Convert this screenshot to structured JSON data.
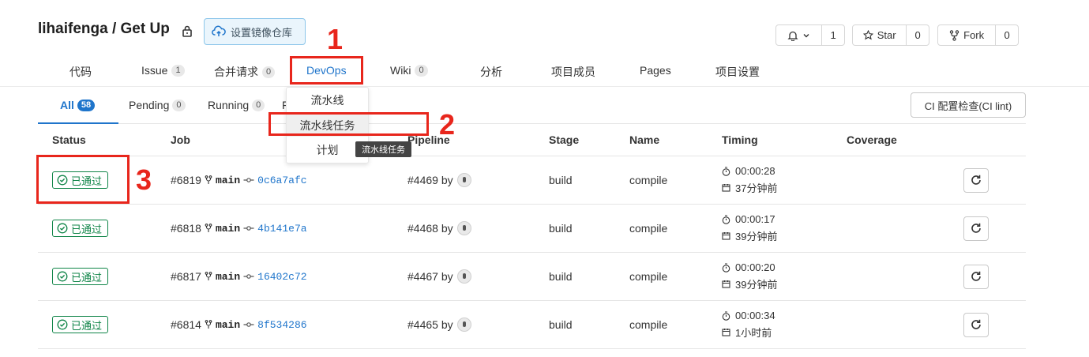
{
  "header": {
    "repo_title": "lihaifenga / Get Up",
    "mirror_button": "设置镜像仓库",
    "notify_count": "1",
    "star_label": "Star",
    "star_count": "0",
    "fork_label": "Fork",
    "fork_count": "0"
  },
  "nav": {
    "items": [
      {
        "label": "代码"
      },
      {
        "label": "Issue",
        "badge": "1"
      },
      {
        "label": "合并请求",
        "badge": "0"
      },
      {
        "label": "DevOps"
      },
      {
        "label": "Wiki",
        "badge": "0"
      },
      {
        "label": "分析"
      },
      {
        "label": "项目成员"
      },
      {
        "label": "Pages"
      },
      {
        "label": "项目设置"
      }
    ]
  },
  "tabs": {
    "items": [
      {
        "label": "All",
        "badge": "58"
      },
      {
        "label": "Pending",
        "badge": "0"
      },
      {
        "label": "Running",
        "badge": "0"
      },
      {
        "label": "F"
      }
    ],
    "ci_lint_button": "CI 配置检查(CI lint)"
  },
  "dropdown": {
    "items": [
      "流水线",
      "流水线任务",
      "计划"
    ],
    "tooltip": "流水线任务"
  },
  "table": {
    "headers": [
      "Status",
      "Job",
      "Pipeline",
      "Stage",
      "Name",
      "Timing",
      "Coverage"
    ],
    "rows": [
      {
        "status": "已通过",
        "job": "#6819",
        "branch": "main",
        "sha": "0c6a7afc",
        "pipeline": "#4469 by",
        "stage": "build",
        "name": "compile",
        "duration": "00:00:28",
        "ago": "37分钟前"
      },
      {
        "status": "已通过",
        "job": "#6818",
        "branch": "main",
        "sha": "4b141e7a",
        "pipeline": "#4468 by",
        "stage": "build",
        "name": "compile",
        "duration": "00:00:17",
        "ago": "39分钟前"
      },
      {
        "status": "已通过",
        "job": "#6817",
        "branch": "main",
        "sha": "16402c72",
        "pipeline": "#4467 by",
        "stage": "build",
        "name": "compile",
        "duration": "00:00:20",
        "ago": "39分钟前"
      },
      {
        "status": "已通过",
        "job": "#6814",
        "branch": "main",
        "sha": "8f534286",
        "pipeline": "#4465 by",
        "stage": "build",
        "name": "compile",
        "duration": "00:00:34",
        "ago": "1小时前"
      }
    ]
  },
  "annotations": [
    "1",
    "2",
    "3"
  ],
  "colors": {
    "accent": "#1f75cb",
    "success": "#108548",
    "annotation_red": "#e8261c"
  }
}
